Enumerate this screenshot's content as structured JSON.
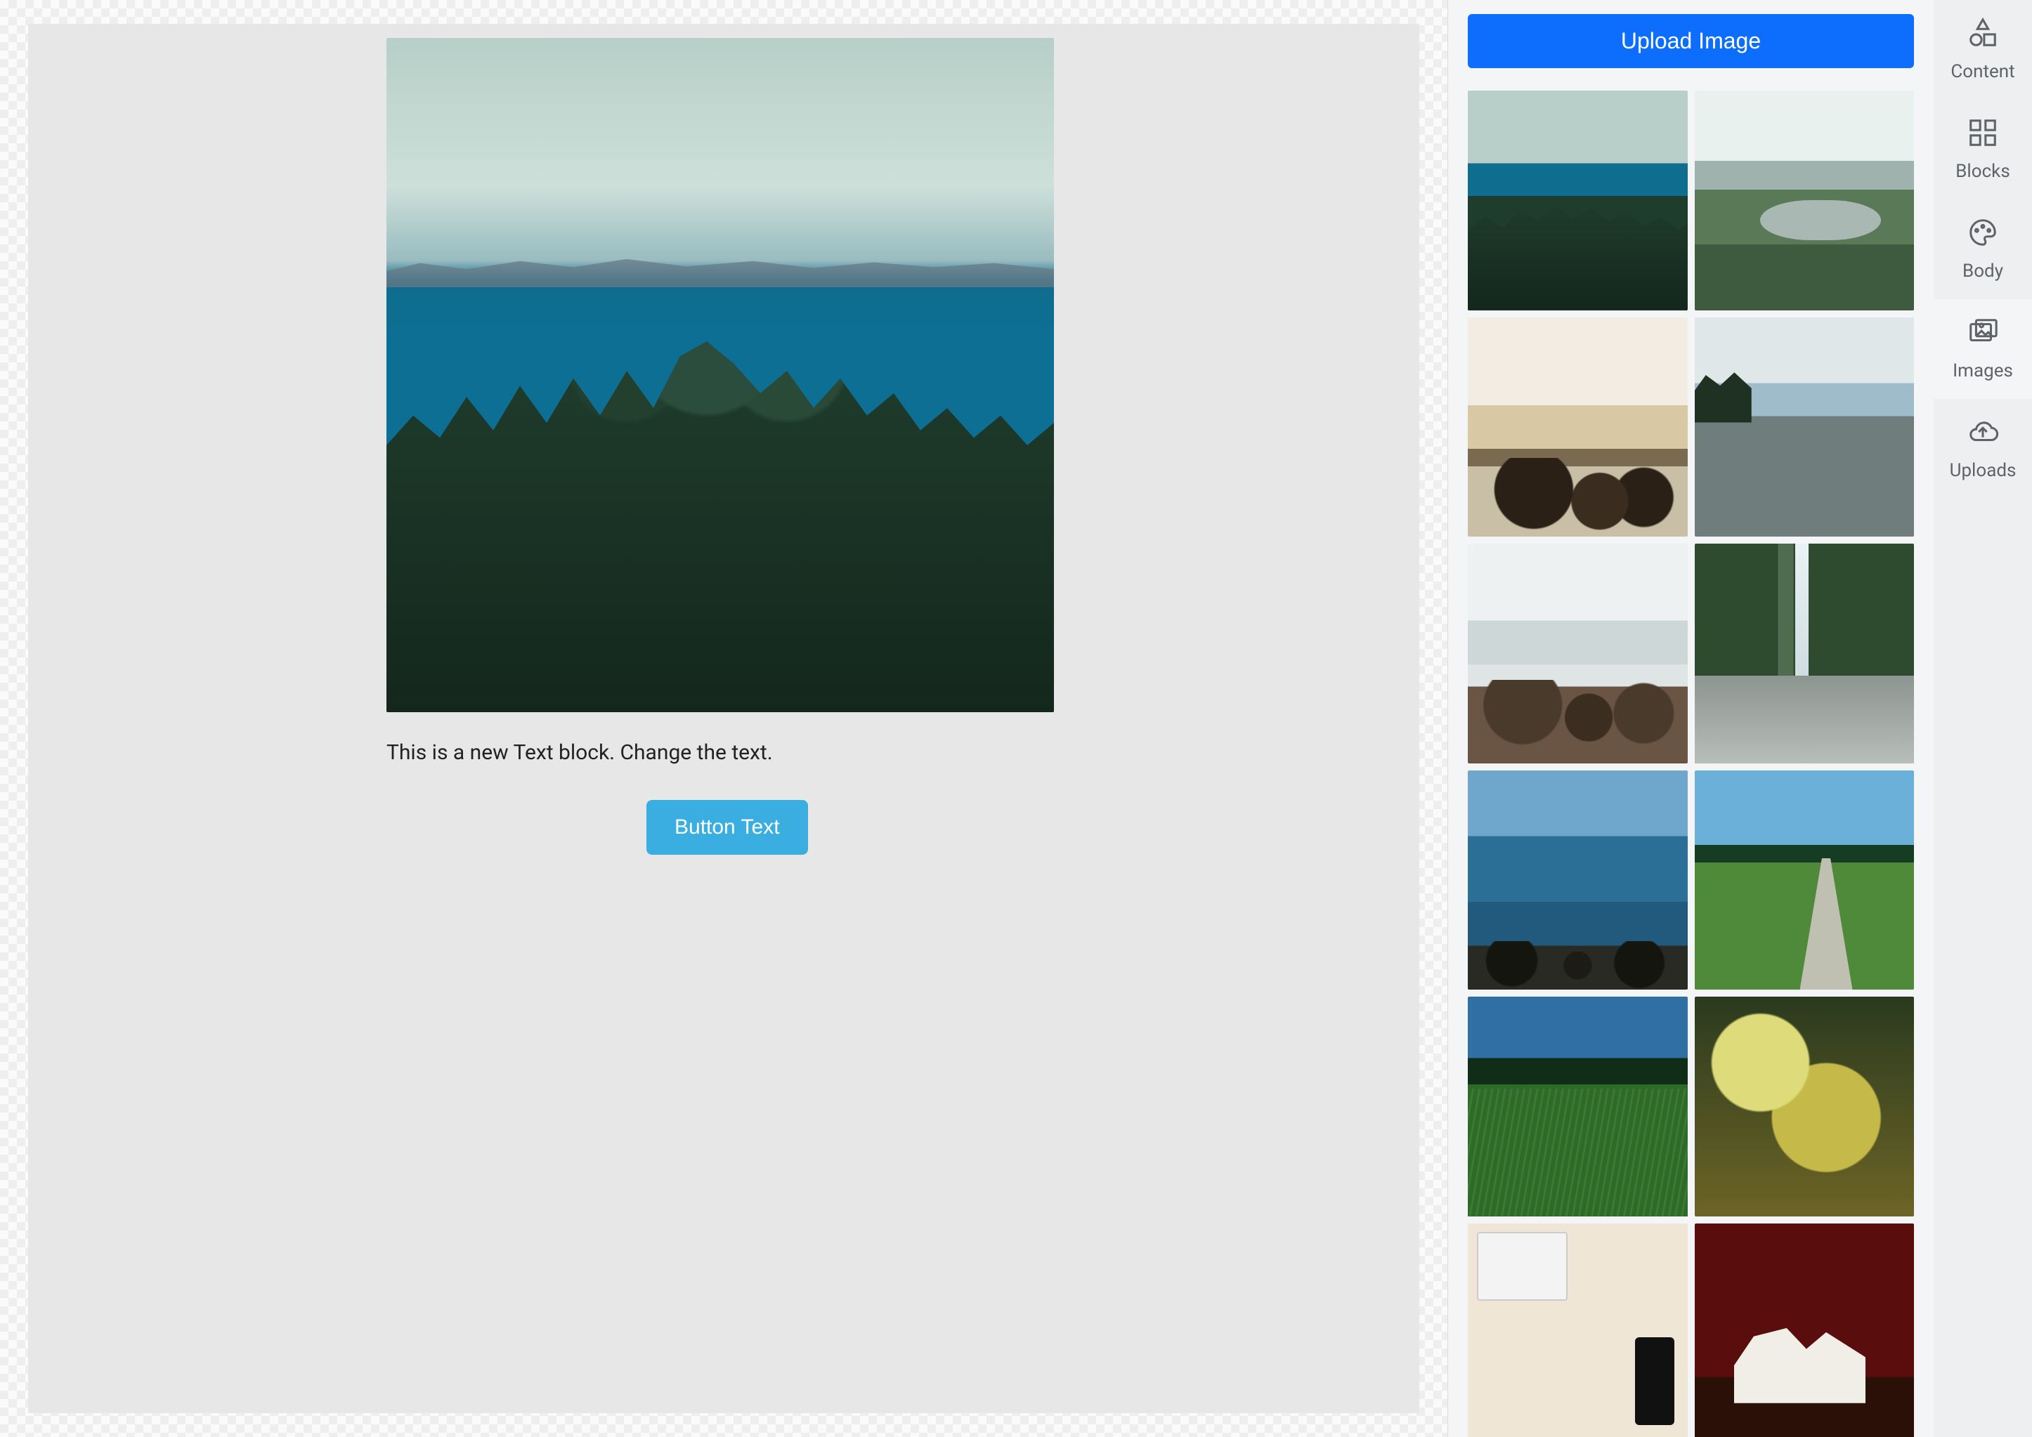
{
  "canvas": {
    "hero_image_name": "forest-sea-landscape",
    "text_block": "This is a new Text block. Change the text.",
    "button_label": "Button Text"
  },
  "images_panel": {
    "upload_button_label": "Upload Image",
    "thumbnails": [
      {
        "name": "forest-sea-landscape",
        "class": "t-forest-sea"
      },
      {
        "name": "meadow-mountain-stream",
        "class": "t-meadow-mtn"
      },
      {
        "name": "beach-dark-rocks",
        "class": "t-beach-rocks"
      },
      {
        "name": "pebble-shore-pines",
        "class": "t-pebble-shore"
      },
      {
        "name": "rocky-coast-overcast",
        "class": "t-rocks-sea"
      },
      {
        "name": "waterfall-gorge",
        "class": "t-waterfall"
      },
      {
        "name": "blue-ocean-shore",
        "class": "t-blue-ocean"
      },
      {
        "name": "path-through-field",
        "class": "t-path-field"
      },
      {
        "name": "tall-grass-trees",
        "class": "t-grass-trees"
      },
      {
        "name": "mossy-tree-sunlight",
        "class": "t-moss-tree"
      },
      {
        "name": "desk-laptop-phone",
        "class": "t-desk"
      },
      {
        "name": "white-heels-red-wall",
        "class": "t-heels"
      }
    ]
  },
  "tool_tabs": {
    "content": "Content",
    "blocks": "Blocks",
    "body": "Body",
    "images": "Images",
    "uploads": "Uploads",
    "active": "images"
  },
  "colors": {
    "primary_button": "#0d6efd",
    "canvas_button": "#3aaee0"
  }
}
